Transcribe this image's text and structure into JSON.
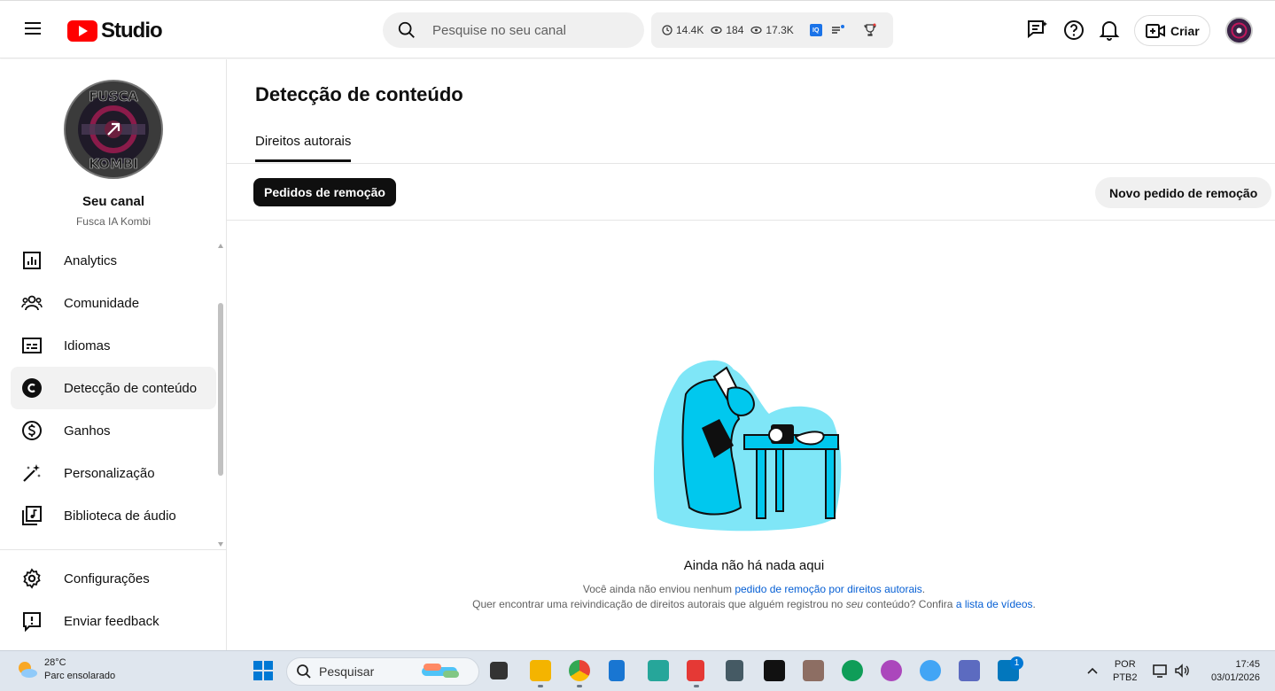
{
  "header": {
    "logo_text": "Studio",
    "search_placeholder": "Pesquise no seu canal",
    "stats": {
      "watch_hours": "14.4K",
      "subscribers": "184",
      "views": "17.3K"
    },
    "iq_badge": "IQ",
    "create_label": "Criar"
  },
  "sidebar": {
    "channel_title": "Seu canal",
    "channel_name": "Fusca IA Kombi",
    "avatar_text_top": "FUSCA",
    "avatar_text_bottom": "KOMBI",
    "items": [
      {
        "label": "Analytics",
        "icon": "analytics-icon"
      },
      {
        "label": "Comunidade",
        "icon": "community-icon"
      },
      {
        "label": "Idiomas",
        "icon": "subtitles-icon"
      },
      {
        "label": "Detecção de conteúdo",
        "icon": "copyright-icon",
        "active": true
      },
      {
        "label": "Ganhos",
        "icon": "dollar-icon"
      },
      {
        "label": "Personalização",
        "icon": "magic-wand-icon"
      },
      {
        "label": "Biblioteca de áudio",
        "icon": "audio-library-icon"
      }
    ],
    "bottom_items": [
      {
        "label": "Configurações",
        "icon": "gear-icon"
      },
      {
        "label": "Enviar feedback",
        "icon": "feedback-icon"
      }
    ]
  },
  "main": {
    "title": "Detecção de conteúdo",
    "tab": "Direitos autorais",
    "chip_active": "Pedidos de remoção",
    "new_request": "Novo pedido de remoção",
    "empty_title": "Ainda não há nada aqui",
    "line1_prefix": "Você ainda não enviou nenhum ",
    "line1_link": "pedido de remoção por direitos autorais",
    "line1_suffix": ".",
    "line2_prefix": "Quer encontrar uma reivindicação de direitos autorais que alguém registrou no ",
    "line2_em": "seu",
    "line2_middle": " conteúdo? Confira ",
    "line2_link": "a lista de vídeos",
    "line2_suffix": "."
  },
  "taskbar": {
    "temperature": "28°C",
    "weather": "Parc ensolarado",
    "search": "Pesquisar",
    "language": "POR",
    "layout": "PTB2",
    "time": "17:45",
    "date": "03/01/2026",
    "store_badge": "1"
  },
  "colors": {
    "accent_red": "#ff0000",
    "link_blue": "#065fd4",
    "illustration_cyan": "#00d4ff",
    "taskbar_bg": "#dfe6ee"
  }
}
